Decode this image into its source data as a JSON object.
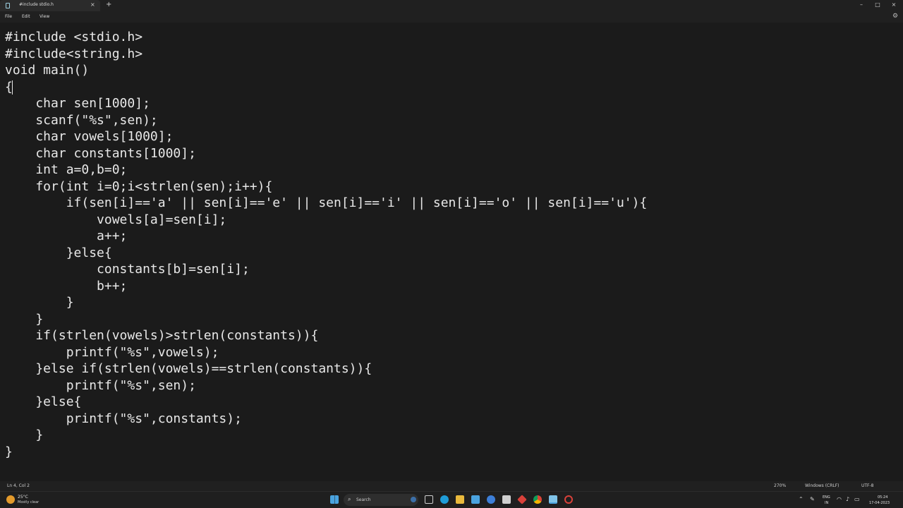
{
  "window": {
    "tab_title": "#include stdio.h",
    "tab_close": "×",
    "new_tab": "+",
    "minimize": "–",
    "maximize": "□",
    "close": "×"
  },
  "menu": {
    "items": [
      "File",
      "Edit",
      "View"
    ],
    "settings_icon": "gear-icon"
  },
  "editor": {
    "lines": [
      "#include <stdio.h>",
      "#include<string.h>",
      "void main()",
      "{",
      "    char sen[1000];",
      "    scanf(\"%s\",sen);",
      "    char vowels[1000];",
      "    char constants[1000];",
      "    int a=0,b=0;",
      "    for(int i=0;i<strlen(sen);i++){",
      "        if(sen[i]=='a' || sen[i]=='e' || sen[i]=='i' || sen[i]=='o' || sen[i]=='u'){",
      "            vowels[a]=sen[i];",
      "            a++;",
      "        }else{",
      "            constants[b]=sen[i];",
      "            b++;",
      "        }",
      "    }",
      "    if(strlen(vowels)>strlen(constants)){",
      "        printf(\"%s\",vowels);",
      "    }else if(strlen(vowels)==strlen(constants)){",
      "        printf(\"%s\",sen);",
      "    }else{",
      "        printf(\"%s\",constants);",
      "    }",
      "}"
    ]
  },
  "status": {
    "position": "Ln 4, Col 2",
    "zoom": "270%",
    "line_ending": "Windows (CRLF)",
    "encoding": "UTF-8"
  },
  "taskbar": {
    "temperature": "25°C",
    "weather": "Mostly clear",
    "search_placeholder": "Search",
    "language_top": "ENG",
    "language_bottom": "IN",
    "time": "05:24",
    "date": "17-04-2023",
    "colors": {
      "accent": "#4aa3df",
      "weather": "#e39a2b"
    }
  }
}
